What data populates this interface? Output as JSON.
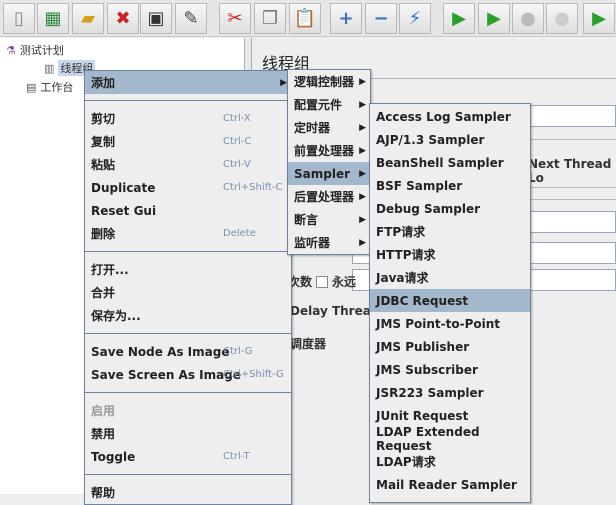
{
  "toolbar": {
    "buttons": [
      {
        "icon": "new-icon",
        "glyph": "▯",
        "color": "#888"
      },
      {
        "icon": "templates-icon",
        "glyph": "▦",
        "color": "#2a8a3a"
      },
      {
        "icon": "open-icon",
        "glyph": "▰",
        "color": "#d9a020"
      },
      {
        "icon": "close-icon",
        "glyph": "✖",
        "color": "#cc2222"
      },
      {
        "icon": "save-icon",
        "glyph": "▣",
        "color": "#333"
      },
      {
        "icon": "save-as-icon",
        "glyph": "✎",
        "color": "#444"
      },
      {
        "icon": "cut-icon",
        "glyph": "✂",
        "color": "#cc2222"
      },
      {
        "icon": "copy-icon",
        "glyph": "❐",
        "color": "#777"
      },
      {
        "icon": "paste-icon",
        "glyph": "📋",
        "color": "#a07020"
      },
      {
        "icon": "expand-icon",
        "glyph": "+",
        "color": "#3a6fc0"
      },
      {
        "icon": "collapse-icon",
        "glyph": "−",
        "color": "#3a6fc0"
      },
      {
        "icon": "toggle-icon",
        "glyph": "⚡",
        "color": "#3a6fc0"
      },
      {
        "icon": "start-icon",
        "glyph": "▶",
        "color": "#2aa02a"
      },
      {
        "icon": "start-no-pause-icon",
        "glyph": "▶",
        "color": "#2aa02a"
      },
      {
        "icon": "stop-icon",
        "glyph": "●",
        "color": "#bbb"
      },
      {
        "icon": "shutdown-icon",
        "glyph": "●",
        "color": "#ccc"
      },
      {
        "icon": "remote-start-icon",
        "glyph": "▶",
        "color": "#2aa02a"
      }
    ]
  },
  "tree": {
    "test_plan": "测试计划",
    "thread_group": "线程组",
    "workbench": "工作台"
  },
  "panel": {
    "title": "线程组",
    "next_thread_loop": "Next Thread Lo",
    "loop_count": "次数",
    "forever": "永远",
    "delay_thread": "Delay Thread c",
    "scheduler": "调度器"
  },
  "menu1": {
    "items": [
      {
        "label": "添加",
        "submenu": true,
        "hover": true
      },
      {
        "sep": true
      },
      {
        "label": "剪切",
        "shortcut": "Ctrl-X"
      },
      {
        "label": "复制",
        "shortcut": "Ctrl-C"
      },
      {
        "label": "粘贴",
        "shortcut": "Ctrl-V"
      },
      {
        "label": "Duplicate",
        "shortcut": "Ctrl+Shift-C"
      },
      {
        "label": "Reset Gui"
      },
      {
        "label": "删除",
        "shortcut": "Delete"
      },
      {
        "sep": true
      },
      {
        "label": "打开..."
      },
      {
        "label": "合并"
      },
      {
        "label": "保存为..."
      },
      {
        "sep": true
      },
      {
        "label": "Save Node As Image",
        "shortcut": "Ctrl-G"
      },
      {
        "label": "Save Screen As Image",
        "shortcut": "Ctrl+Shift-G"
      },
      {
        "sep": true
      },
      {
        "label": "启用",
        "disabled": true
      },
      {
        "label": "禁用"
      },
      {
        "label": "Toggle",
        "shortcut": "Ctrl-T"
      },
      {
        "sep": true
      },
      {
        "label": "帮助"
      }
    ]
  },
  "menu2": {
    "items": [
      {
        "label": "逻辑控制器",
        "submenu": true
      },
      {
        "label": "配置元件",
        "submenu": true
      },
      {
        "label": "定时器",
        "submenu": true
      },
      {
        "label": "前置处理器",
        "submenu": true
      },
      {
        "label": "Sampler",
        "submenu": true,
        "hover": true
      },
      {
        "label": "后置处理器",
        "submenu": true
      },
      {
        "label": "断言",
        "submenu": true
      },
      {
        "label": "监听器",
        "submenu": true
      }
    ]
  },
  "menu3": {
    "items": [
      {
        "label": "Access Log Sampler"
      },
      {
        "label": "AJP/1.3 Sampler"
      },
      {
        "label": "BeanShell Sampler"
      },
      {
        "label": "BSF Sampler"
      },
      {
        "label": "Debug Sampler"
      },
      {
        "label": "FTP请求"
      },
      {
        "label": "HTTP请求"
      },
      {
        "label": "Java请求"
      },
      {
        "label": "JDBC Request",
        "hover": true
      },
      {
        "label": "JMS Point-to-Point"
      },
      {
        "label": "JMS Publisher"
      },
      {
        "label": "JMS Subscriber"
      },
      {
        "label": "JSR223 Sampler"
      },
      {
        "label": "JUnit Request"
      },
      {
        "label": "LDAP Extended Request"
      },
      {
        "label": "LDAP请求"
      },
      {
        "label": "Mail Reader Sampler"
      }
    ]
  }
}
